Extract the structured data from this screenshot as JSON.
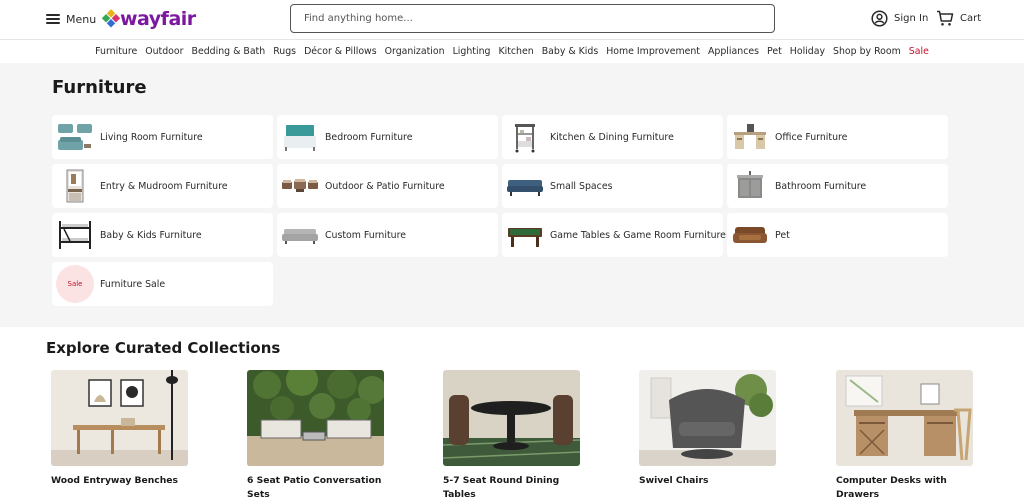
{
  "header": {
    "menu_label": "Menu",
    "logo_text": "wayfair",
    "search_placeholder": "Find anything home...",
    "sign_in_label": "Sign In",
    "cart_label": "Cart",
    "brand_color": "#7b189f"
  },
  "nav": {
    "items": [
      {
        "label": "Furniture"
      },
      {
        "label": "Outdoor"
      },
      {
        "label": "Bedding & Bath"
      },
      {
        "label": "Rugs"
      },
      {
        "label": "Décor & Pillows"
      },
      {
        "label": "Organization"
      },
      {
        "label": "Lighting"
      },
      {
        "label": "Kitchen"
      },
      {
        "label": "Baby & Kids"
      },
      {
        "label": "Home Improvement"
      },
      {
        "label": "Appliances"
      },
      {
        "label": "Pet"
      },
      {
        "label": "Holiday"
      },
      {
        "label": "Shop by Room"
      },
      {
        "label": "Sale"
      }
    ],
    "sale_color": "#c8102e"
  },
  "furniture": {
    "title": "Furniture",
    "categories": [
      {
        "label": "Living Room Furniture",
        "icon": "sofa-set-icon"
      },
      {
        "label": "Bedroom Furniture",
        "icon": "bed-icon"
      },
      {
        "label": "Kitchen & Dining Furniture",
        "icon": "kitchen-cart-icon"
      },
      {
        "label": "Office Furniture",
        "icon": "desk-icon"
      },
      {
        "label": "Entry & Mudroom Furniture",
        "icon": "hall-tree-icon"
      },
      {
        "label": "Outdoor & Patio Furniture",
        "icon": "patio-set-icon"
      },
      {
        "label": "Small Spaces",
        "icon": "small-sofa-icon"
      },
      {
        "label": "Bathroom Furniture",
        "icon": "vanity-icon"
      },
      {
        "label": "Baby & Kids Furniture",
        "icon": "bunk-bed-icon"
      },
      {
        "label": "Custom Furniture",
        "icon": "grey-sofa-icon"
      },
      {
        "label": "Game Tables & Game Room Furniture",
        "icon": "pool-table-icon"
      },
      {
        "label": "Pet",
        "icon": "pet-sofa-icon"
      },
      {
        "label": "Furniture Sale",
        "icon": "sale-badge-icon",
        "badge": "Sale"
      }
    ]
  },
  "curated": {
    "title": "Explore Curated Collections",
    "items": [
      {
        "label": "Wood Entryway Benches"
      },
      {
        "label": "6 Seat Patio Conversation Sets"
      },
      {
        "label": "5-7 Seat Round Dining Tables"
      },
      {
        "label": "Swivel Chairs"
      },
      {
        "label": "Computer Desks with Drawers"
      }
    ]
  }
}
